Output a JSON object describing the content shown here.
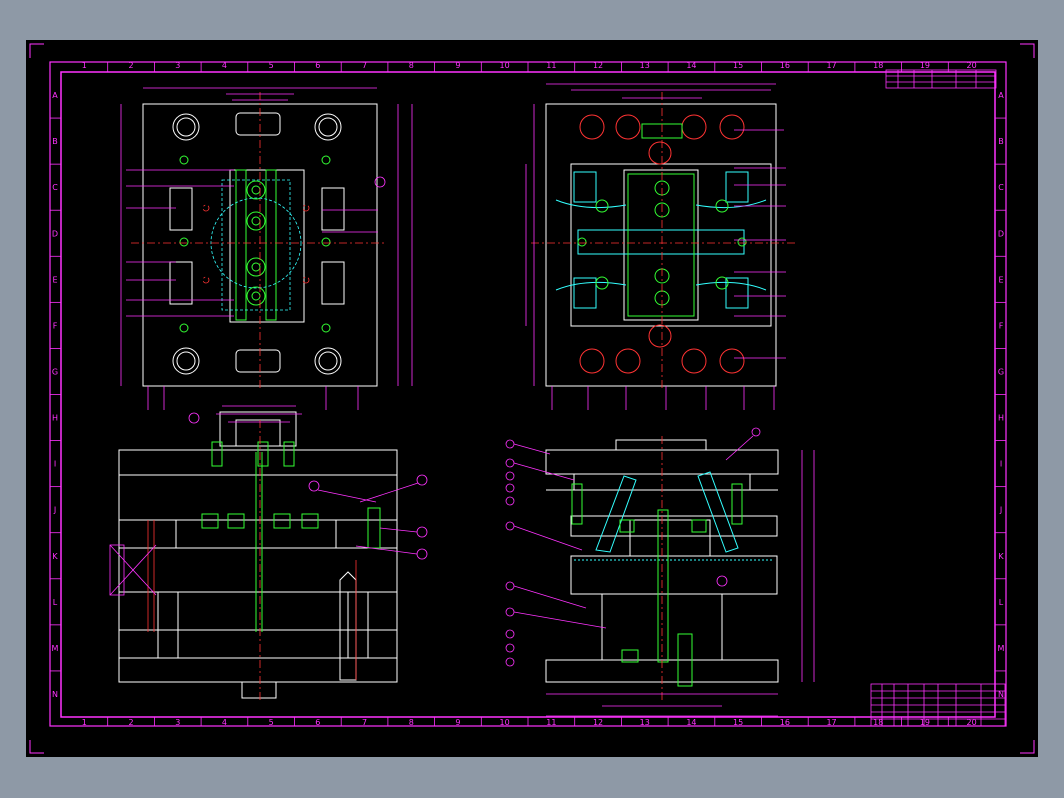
{
  "drawing": {
    "column_labels": [
      "1",
      "2",
      "3",
      "4",
      "5",
      "6",
      "7",
      "8",
      "9",
      "10",
      "11",
      "12",
      "13",
      "14",
      "15",
      "16",
      "17",
      "18",
      "19",
      "20"
    ],
    "row_labels": [
      "A",
      "B",
      "C",
      "D",
      "E",
      "F",
      "G",
      "H",
      "I",
      "J",
      "K",
      "L",
      "M",
      "N"
    ]
  },
  "colors": {
    "background": "#000000",
    "frame": "#ff33ff",
    "outline": "#ffffff",
    "dimension": "#ff33ff",
    "dim_text": "#33ff33",
    "center": "#ff3333",
    "part_cyan": "#33ffff",
    "part_green": "#33ff33",
    "hidden_yellow": "#ffff33"
  }
}
